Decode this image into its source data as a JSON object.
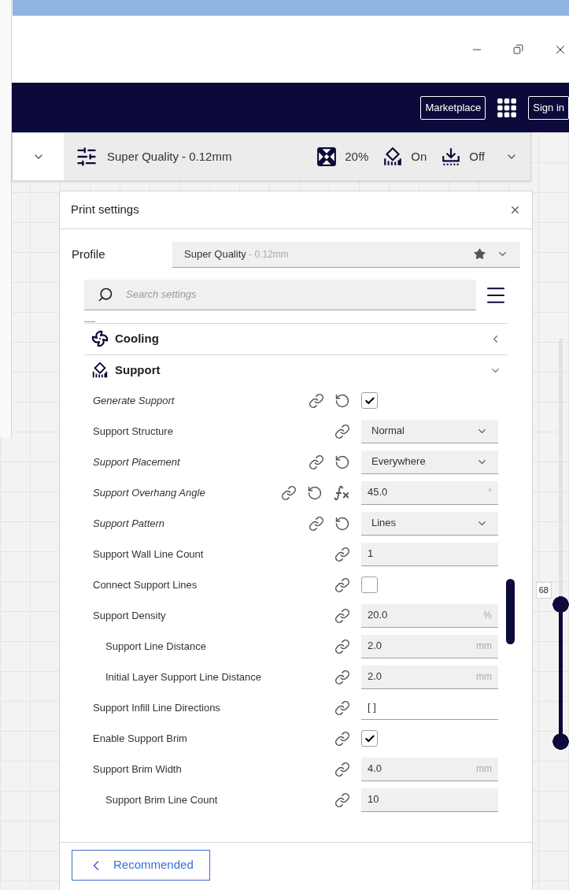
{
  "header": {
    "buttons": [
      {
        "label": "Marketplace"
      },
      {
        "label": "Sign in"
      }
    ]
  },
  "toolbar": {
    "profile": "Super Quality - 0.12mm",
    "infill": "20%",
    "support": "On",
    "adhesion": "Off"
  },
  "panel": {
    "title": "Print settings",
    "profile_label": "Profile",
    "profile_name": "Super Quality",
    "profile_variant": " - 0.12mm",
    "search_placeholder": "Search settings",
    "categories": [
      {
        "kind": "cooling",
        "name": "Cooling",
        "expanded": false
      },
      {
        "kind": "support",
        "name": "Support",
        "expanded": true,
        "settings": [
          {
            "label": "Generate Support",
            "kind": "checkbox",
            "checked": true,
            "modified": true,
            "formula": false
          },
          {
            "label": "Support Structure",
            "kind": "dropdown",
            "value": "Normal",
            "modified": false,
            "formula": false
          },
          {
            "label": "Support Placement",
            "kind": "dropdown",
            "value": "Everywhere",
            "modified": true,
            "formula": false
          },
          {
            "label": "Support Overhang Angle",
            "kind": "number",
            "value": "45.0",
            "unit": "°",
            "modified": true,
            "formula": true
          },
          {
            "label": "Support Pattern",
            "kind": "dropdown",
            "value": "Lines",
            "modified": true,
            "formula": false
          },
          {
            "label": "Support Wall Line Count",
            "kind": "number",
            "value": "1",
            "modified": false,
            "formula": false
          },
          {
            "label": "Connect Support Lines",
            "kind": "checkbox",
            "checked": false,
            "modified": false,
            "formula": false
          },
          {
            "label": "Support Density",
            "kind": "number",
            "value": "20.0",
            "unit": "%",
            "modified": false,
            "formula": false,
            "children": [
              {
                "label": "Support Line Distance",
                "kind": "number",
                "value": "2.0",
                "unit": "mm",
                "modified": false,
                "formula": false
              },
              {
                "label": "Initial Layer Support Line Distance",
                "kind": "number",
                "value": "2.0",
                "unit": "mm",
                "modified": false,
                "formula": false
              }
            ]
          },
          {
            "label": "Support Infill Line Directions",
            "kind": "text",
            "value": "[ ]",
            "modified": false,
            "formula": false
          },
          {
            "label": "Enable Support Brim",
            "kind": "checkbox",
            "checked": true,
            "modified": false,
            "formula": false
          },
          {
            "label": "Support Brim Width",
            "kind": "number",
            "value": "4.0",
            "unit": "mm",
            "modified": false,
            "formula": false,
            "children": [
              {
                "label": "Support Brim Line Count",
                "kind": "number",
                "value": "10",
                "modified": false,
                "formula": false
              }
            ]
          }
        ]
      }
    ],
    "footer_button": "Recommended"
  },
  "layer_slider": {
    "label": "68",
    "level": 0.34
  }
}
